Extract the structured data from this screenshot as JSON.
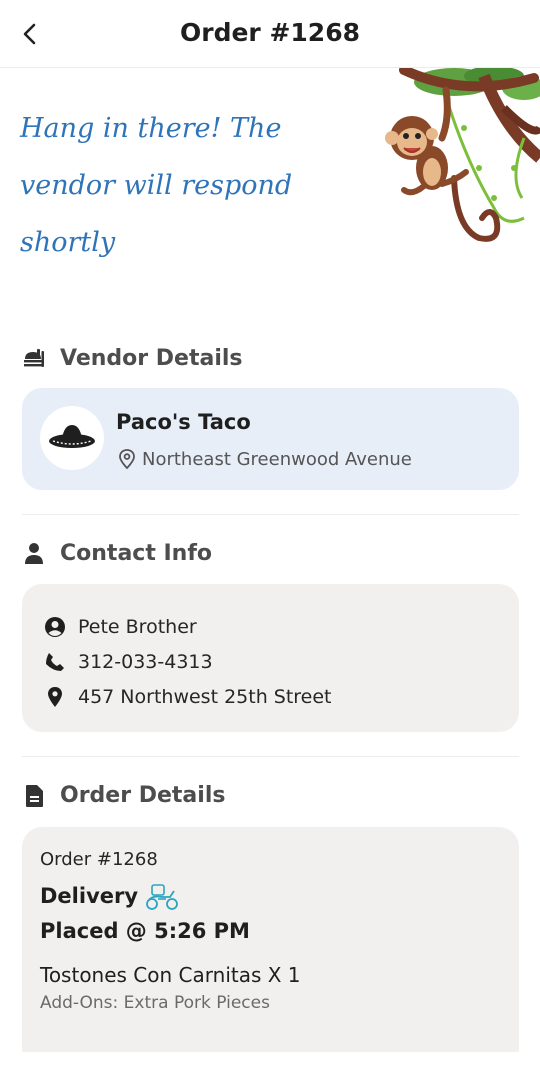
{
  "header": {
    "title": "Order #1268"
  },
  "banner": {
    "message": "Hang in there! The vendor will respond shortly"
  },
  "vendor_section": {
    "label": "Vendor Details",
    "name": "Paco's Taco",
    "address": "Northeast Greenwood Avenue"
  },
  "contact_section": {
    "label": "Contact Info",
    "name": "Pete Brother",
    "phone": "312-033-4313",
    "address": "457 Northwest 25th Street"
  },
  "order_section": {
    "label": "Order Details",
    "order_number": "Order #1268",
    "type": "Delivery",
    "placed": "Placed @ 5:26 PM",
    "item": "Tostones Con Carnitas X 1",
    "addons_label": "Add-Ons:",
    "addons_value": "Extra Pork Pieces"
  },
  "colors": {
    "banner_text": "#2f74b9",
    "vendor_card": "#e7eef8",
    "card": "#f2f0ee"
  }
}
